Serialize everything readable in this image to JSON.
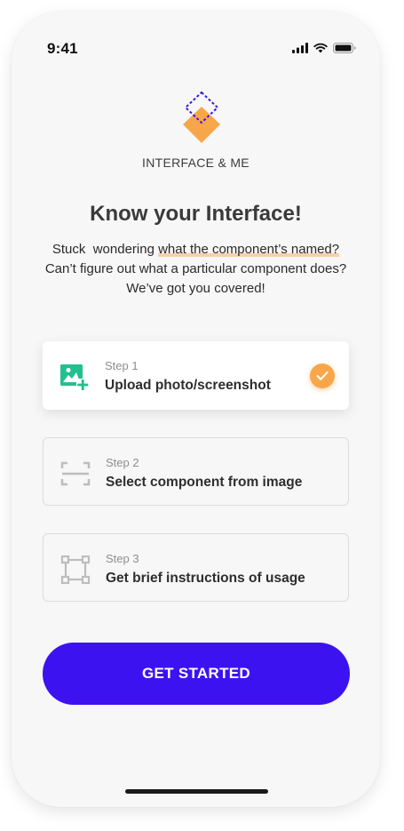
{
  "status_bar": {
    "time": "9:41",
    "icons": [
      "cellular-signal-icon",
      "wifi-icon",
      "battery-icon"
    ]
  },
  "brand": {
    "name": "INTERFACE & ME",
    "logo_colors": {
      "diamond_fill": "#f7a74a",
      "outline": "#3d12f0"
    }
  },
  "hero": {
    "title": "Know your Interface!",
    "desc_prefix": "Stuck  wondering ",
    "desc_highlight": "what the component’s named?",
    "desc_line2": "Can’t figure out what a particular component does?",
    "desc_line3": "We’ve got you covered!"
  },
  "steps": [
    {
      "number": "Step 1",
      "title": "Upload photo/screenshot",
      "icon": "add-image-icon",
      "completed": true
    },
    {
      "number": "Step 2",
      "title": "Select component from image",
      "icon": "select-frame-icon",
      "completed": false
    },
    {
      "number": "Step 3",
      "title": "Get brief instructions of usage",
      "icon": "bounding-box-icon",
      "completed": false
    }
  ],
  "cta": {
    "label": "GET STARTED"
  },
  "colors": {
    "accent": "#3d12f0",
    "orange": "#f7a74a",
    "green": "#22c08e",
    "background": "#f7f7f7"
  }
}
